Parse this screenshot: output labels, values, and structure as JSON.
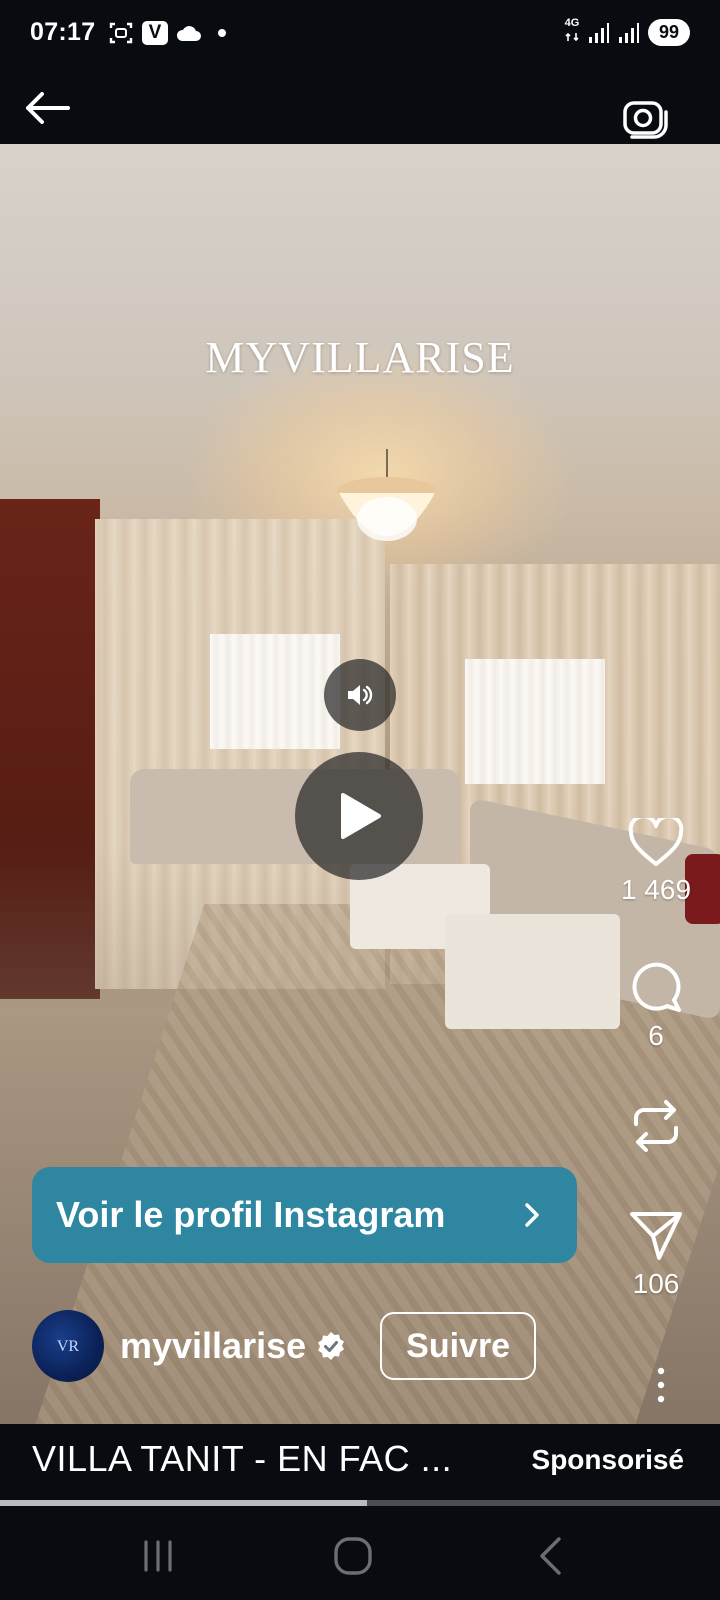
{
  "status_bar": {
    "time": "07:17",
    "network_label": "4G",
    "battery": "99",
    "icons": [
      "screenshot-icon",
      "v-app-icon",
      "cloud-icon",
      "notification-dot",
      "signal-icon",
      "signal-icon",
      "battery-icon"
    ]
  },
  "top_bar": {
    "icons": [
      "back-arrow-icon",
      "camera-icon"
    ]
  },
  "video": {
    "brand_overlay": "MYVILLARISE",
    "state": "paused",
    "controls": [
      "volume-icon",
      "play-icon"
    ]
  },
  "actions": {
    "likes": "1 469",
    "comments": "6",
    "shares": "106",
    "icons": [
      "heart-icon",
      "comment-icon",
      "repost-icon",
      "send-icon",
      "more-vertical-icon"
    ]
  },
  "cta": {
    "label": "Voir le profil Instagram"
  },
  "profile": {
    "username": "myvillarise",
    "verified": true,
    "follow_label": "Suivre"
  },
  "caption": {
    "text": "VILLA TANIT - EN FAC ...",
    "sponsored_label": "Sponsorisé"
  },
  "playback": {
    "progress_fraction": 0.51
  },
  "nav": {
    "icons": [
      "recents-icon",
      "home-icon",
      "back-icon"
    ]
  },
  "colors": {
    "background": "#080b10",
    "cta": "#2f86a0",
    "text": "#ffffff"
  }
}
